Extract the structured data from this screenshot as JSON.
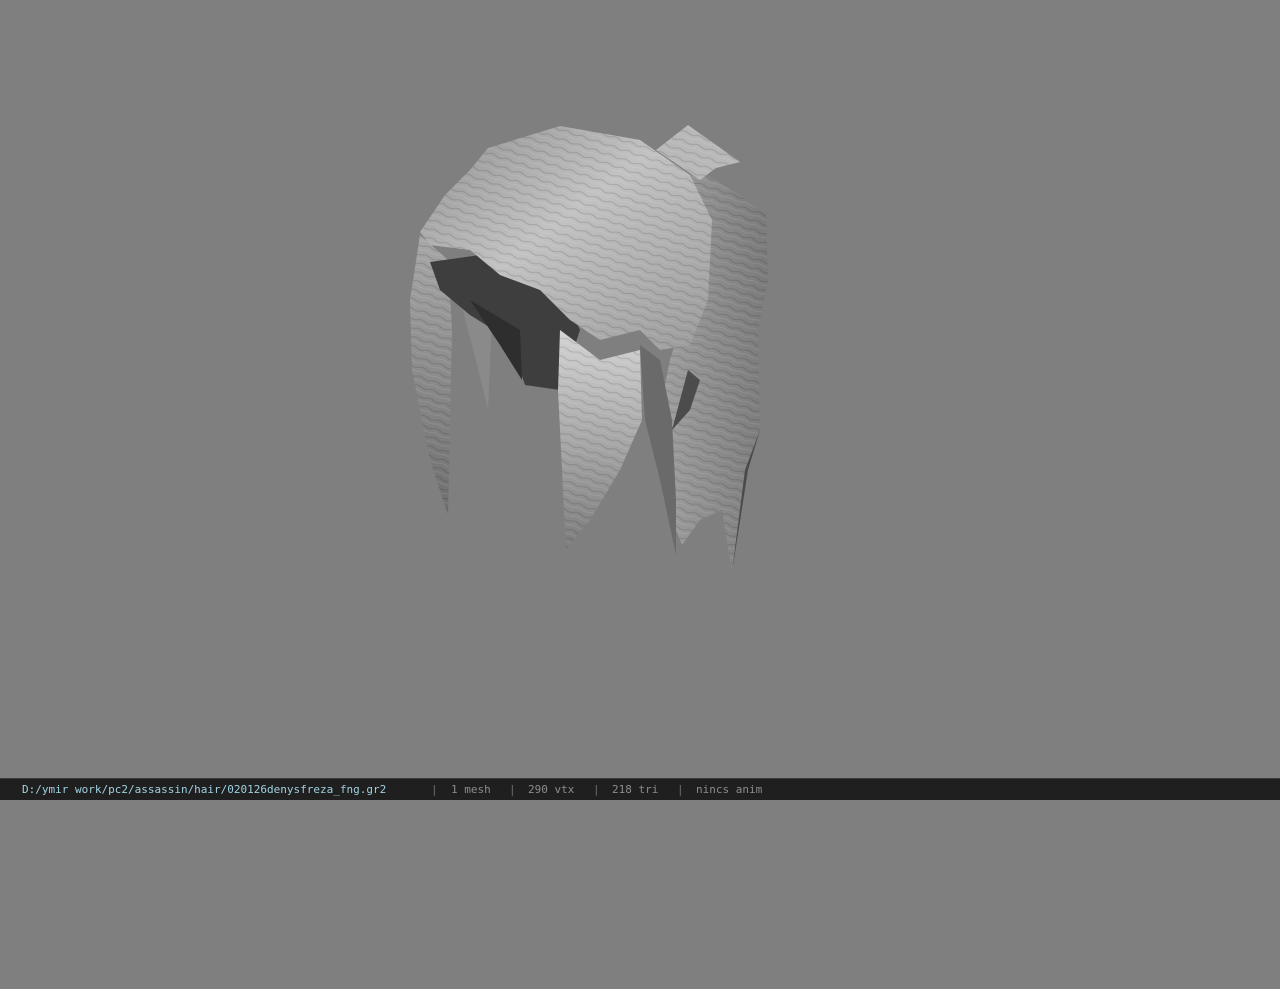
{
  "viewport": {
    "background": "#7f7f7f",
    "model": {
      "kind": "hair-mesh-preview",
      "base_color": "#b4b4b4",
      "shadow_color": "#3c3c3c"
    }
  },
  "statusbar": {
    "file_path": "D:/ymir work/pc2/assassin/hair/020126denysfreza_fng.gr2",
    "separator": "|",
    "mesh_count": "1 mesh",
    "vertex_count": "290 vtx",
    "triangle_count": "218 tri",
    "anim_status": "nincs anim"
  }
}
